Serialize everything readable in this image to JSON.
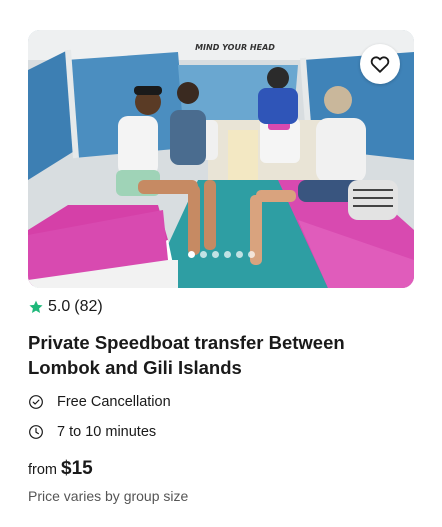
{
  "listing": {
    "image": {
      "description": "",
      "sign_text": "MIND YOUR HEAD",
      "carousel_dots": 6,
      "active_dot": 0
    },
    "wishlist_icon": "heart-outline-icon",
    "rating": {
      "star_icon": "star-icon",
      "star_color": "#1fb87a",
      "score": "5.0",
      "count": "(82)"
    },
    "title": "Private Speedboat transfer Between Lombok and Gili Islands",
    "features": [
      {
        "icon": "check-circle-icon",
        "label": "Free Cancellation"
      },
      {
        "icon": "clock-icon",
        "label": "7 to 10 minutes"
      }
    ],
    "price": {
      "prefix": "from",
      "amount": "$15",
      "note": "Price varies by group size"
    }
  }
}
